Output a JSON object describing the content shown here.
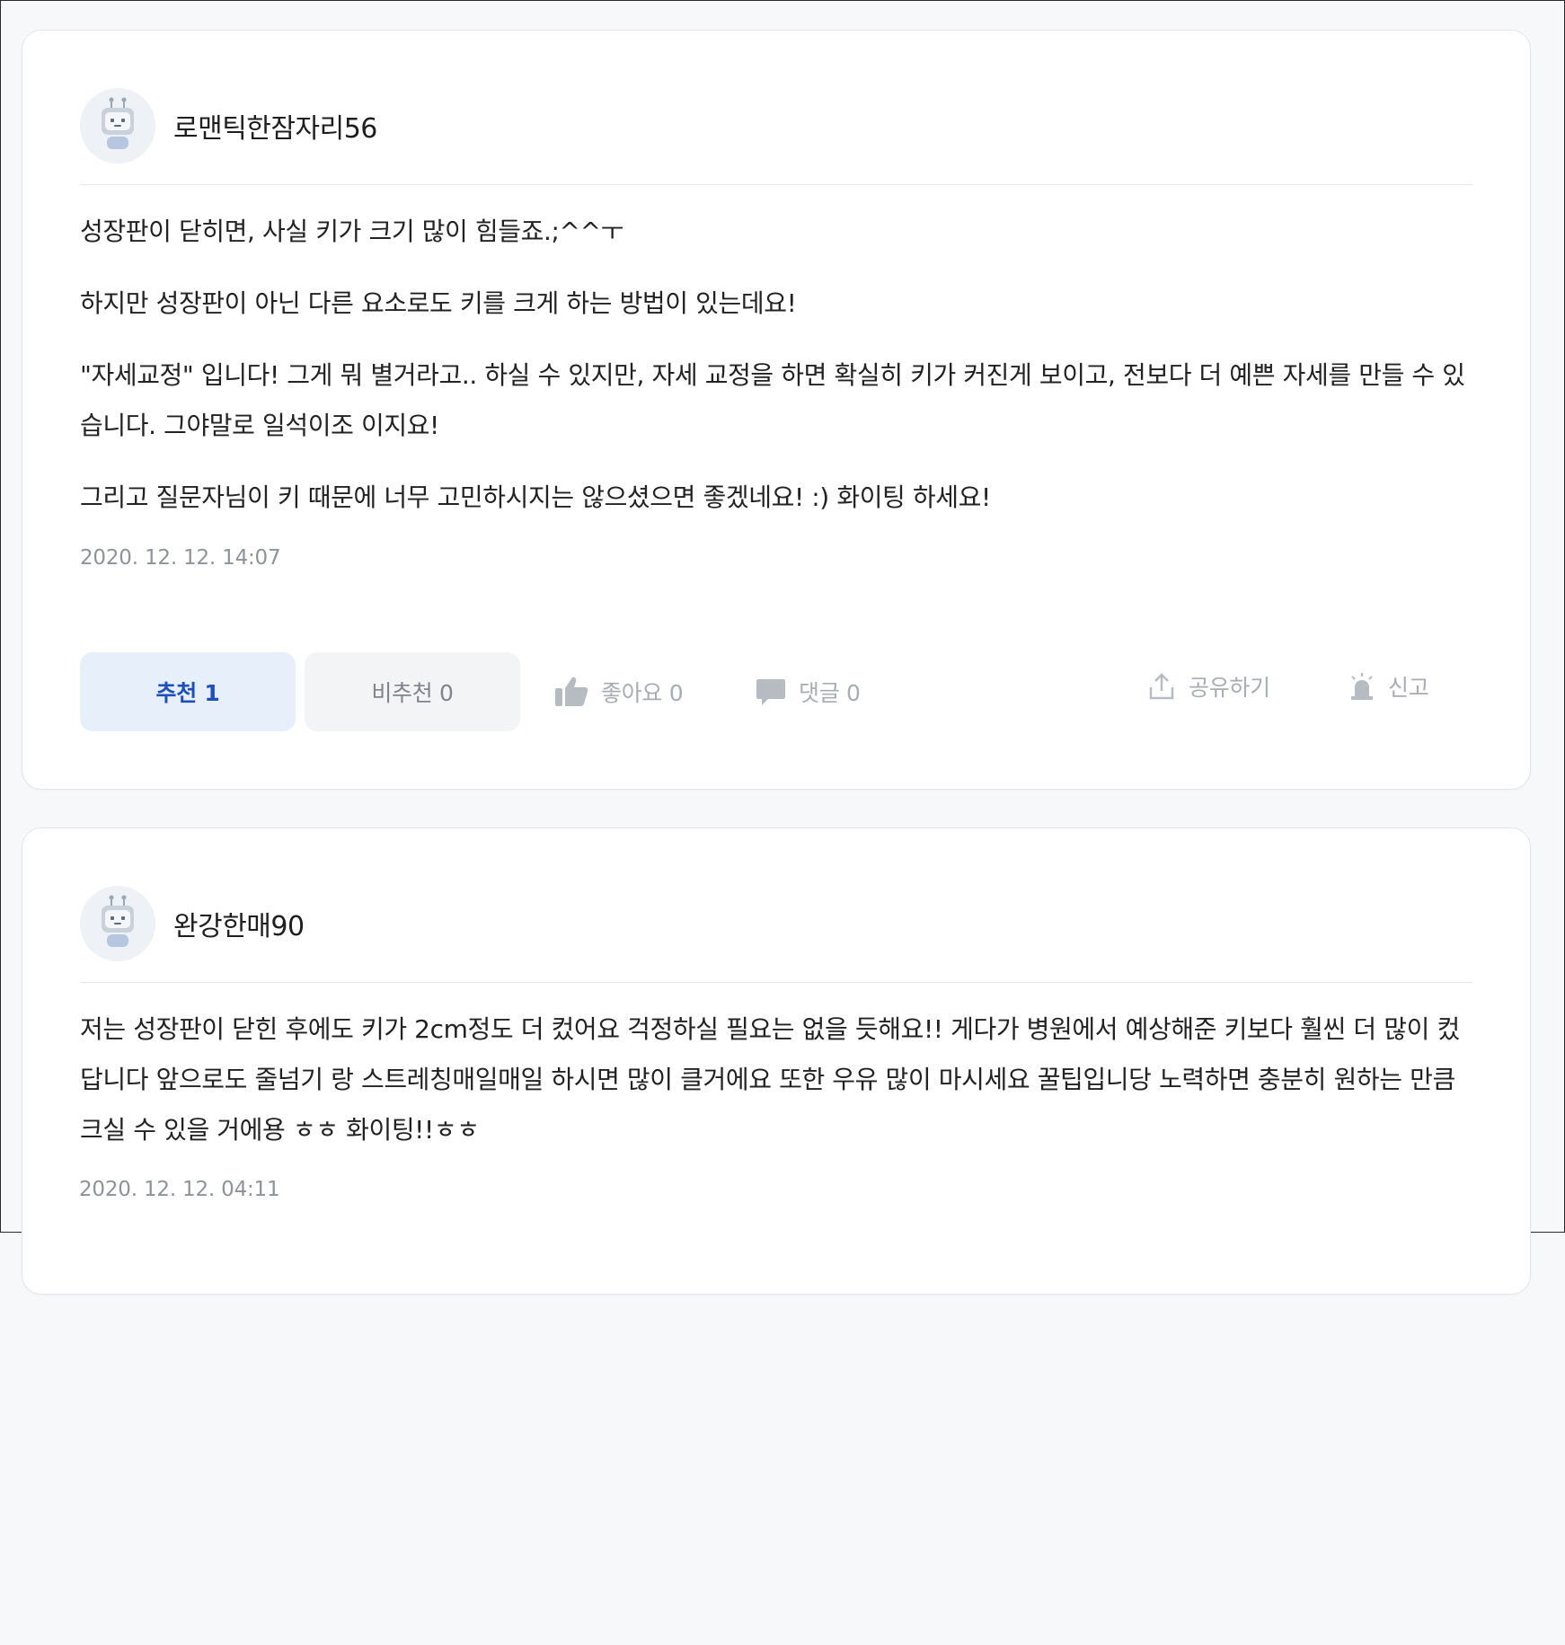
{
  "answers": [
    {
      "author": "로맨틱한잠자리56",
      "paragraphs": [
        "성장판이 닫히면, 사실 키가 크기 많이 힘들죠.;^^ㅜ",
        "하지만 성장판이 아닌 다른 요소로도 키를 크게 하는 방법이 있는데요!",
        "\"자세교정\" 입니다! 그게 뭐 별거라고.. 하실 수 있지만, 자세 교정을 하면 확실히 키가 커진게 보이고, 전보다 더 예쁜 자세를 만들 수 있습니다. 그야말로 일석이조 이지요!",
        "그리고 질문자님이 키 때문에 너무 고민하시지는 않으셨으면 좋겠네요! :) 화이팅 하세요!"
      ],
      "timestamp": "2020. 12. 12. 14:07",
      "recommend_label": "추천 1",
      "unrecommend_label": "비추천 0",
      "like_label": "좋아요 0",
      "comment_label": "댓글 0",
      "share_label": "공유하기",
      "report_label": "신고"
    },
    {
      "author": "완강한매90",
      "paragraphs": [
        "저는 성장판이 닫힌 후에도 키가 2cm정도 더 컸어요 걱정하실 필요는 없을 듯해요!! 게다가 병원에서 예상해준 키보다 훨씬 더 많이 컸답니다 앞으로도 줄넘기 랑 스트레칭매일매일 하시면 많이 클거에요 또한 우유 많이 마시세요 꿀팁입니당 노력하면 충분히 원하는 만큼 크실 수 있을 거에용 ㅎㅎ 화이팅!!ㅎㅎ"
      ],
      "timestamp": "2020. 12. 12. 04:11"
    }
  ],
  "icons": {
    "avatar": "robot-avatar-icon",
    "like": "thumbs-up-icon",
    "comment": "speech-bubble-icon",
    "share": "share-upload-icon",
    "report": "siren-icon"
  },
  "colors": {
    "accent": "#1f4fbf",
    "recommend_bg": "#e7f0fa",
    "muted": "#a7adb3"
  }
}
